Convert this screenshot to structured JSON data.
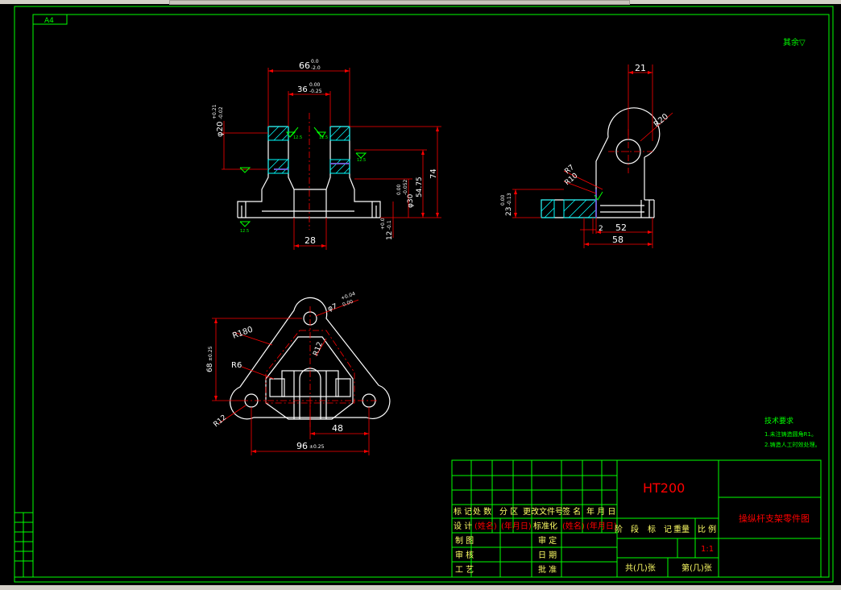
{
  "sheet": {
    "size_label": "A4",
    "roughness_note": "其余▽",
    "tech": {
      "heading": "技术要求",
      "items": [
        "1.未注铸造圆角R1。",
        "2.铸造人工时效处理。"
      ]
    }
  },
  "front_view": {
    "dim_width_outer": "66",
    "tol_width_outer": [
      "0.0",
      "-2.0"
    ],
    "dim_width_inner": "36",
    "tol_width_inner": [
      "0.00",
      "-0.25"
    ],
    "dim_hole": "φ20",
    "tol_hole": [
      "+0.21",
      "-0.02"
    ],
    "dim_height": "74",
    "dim_mid_height": "54.75",
    "dim_bore": "φ30",
    "tol_bore": [
      "0.00",
      "-0.052"
    ],
    "dim_base_thk": "12",
    "tol_base_thk": [
      "+0.0",
      "-0.1"
    ],
    "dim_bottom": "28",
    "roughness": [
      "12.5",
      "12.5",
      "12.5",
      "12.5"
    ]
  },
  "side_view": {
    "dim_top": "21",
    "dim_radius_big": "R20",
    "dim_radius_fillet": "R7",
    "dim_radius_10": "R10",
    "dim_height": "23",
    "tol_height": [
      "0.00",
      "-0.13"
    ],
    "dim_52": "52",
    "dim_2": "2",
    "dim_58": "58"
  },
  "top_view": {
    "dim_hole": "φ7",
    "tol_hole": [
      "+0.04",
      "0.00"
    ],
    "dim_r180": "R180",
    "dim_r12_inner": "R12",
    "dim_r6": "R6",
    "dim_height": "68",
    "tol_height": "±0.25",
    "dim_r12": "R12",
    "dim_48": "48",
    "dim_96": "96",
    "tol_96": "±0.25"
  },
  "title_block": {
    "material": "HT200",
    "drawing_name": "操纵杆支架零件图",
    "header_row": [
      "标 记",
      "处 数",
      "分 区",
      "更改文件号",
      "签 名",
      "年 月 日"
    ],
    "design_row": [
      "设 计",
      "(姓名)",
      "(年月日)",
      "标准化",
      "(姓名)",
      "(年月日)"
    ],
    "labels_left": [
      "制 图",
      "审 核",
      "工 艺"
    ],
    "labels_mid": [
      "重 量",
      "比 例",
      "审 定",
      "日 期",
      "批 准"
    ],
    "stage_row": [
      "阶",
      "段",
      "标",
      "记",
      "重量",
      "比 例"
    ],
    "scale": "1:1",
    "sheets_total": "共(几)张",
    "sheet_no": "第(几)张"
  },
  "colors": {
    "border": "#00ff00",
    "object": "#ffffff",
    "dimension": "#ff0000",
    "hatch": "#00ffff",
    "roughness": "#00ff00"
  }
}
